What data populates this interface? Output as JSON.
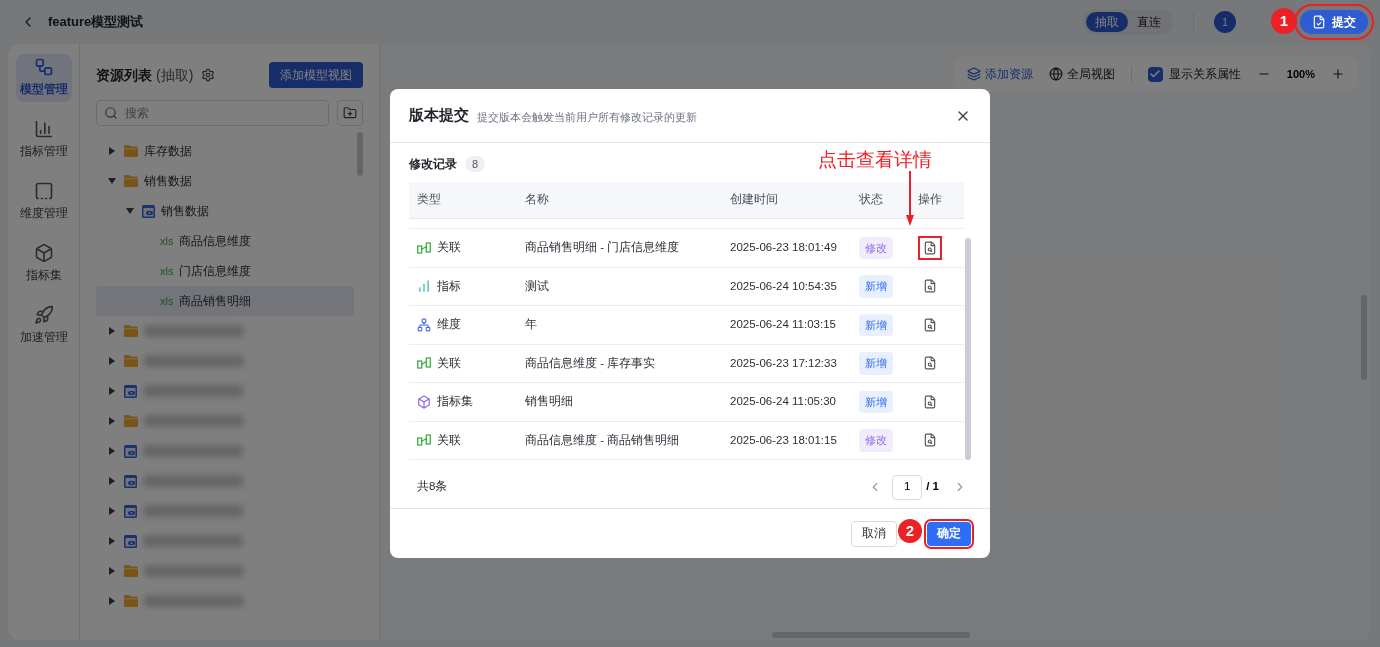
{
  "header": {
    "title": "feature模型测试",
    "mode_toggle": [
      {
        "label": "抽取",
        "selected": true
      },
      {
        "label": "直连",
        "selected": false
      }
    ],
    "avatar": "1",
    "submit_button": {
      "label": "提交",
      "highlighted": true
    }
  },
  "nav": [
    {
      "label": "模型管理",
      "kind": "model",
      "selected": true
    },
    {
      "label": "指标管理",
      "kind": "metric",
      "selected": false
    },
    {
      "label": "维度管理",
      "kind": "dimension",
      "selected": false
    },
    {
      "label": "指标集",
      "kind": "metric_set",
      "selected": false
    },
    {
      "label": "加速管理",
      "kind": "accelerate",
      "selected": false
    }
  ],
  "resource_panel": {
    "title": "资源列表",
    "mode": "(抽取)",
    "add_button": "添加模型视图",
    "search": {
      "placeholder": "搜索"
    },
    "tree": [
      {
        "label": "库存数据",
        "kind": "folder",
        "expanded": false,
        "selected": false
      },
      {
        "label": "销售数据",
        "kind": "folder",
        "expanded": true,
        "selected": false,
        "children": [
          {
            "label": "销售数据",
            "kind": "view",
            "expanded": true,
            "selected": false,
            "children": [
              {
                "label": "商品信息维度",
                "kind": "xls",
                "icon_text": "xls",
                "selected": false
              },
              {
                "label": "门店信息维度",
                "kind": "xls",
                "icon_text": "xls",
                "selected": false
              },
              {
                "label": "商品销售明细",
                "kind": "xls",
                "icon_text": "xls",
                "selected": true
              }
            ]
          }
        ]
      },
      {
        "kind": "folder",
        "expanded": false,
        "selected": false
      },
      {
        "kind": "folder",
        "expanded": false,
        "selected": false
      },
      {
        "kind": "view",
        "expanded": false,
        "selected": false
      },
      {
        "kind": "folder",
        "expanded": false,
        "selected": false
      },
      {
        "kind": "view",
        "expanded": false,
        "selected": false
      },
      {
        "kind": "view",
        "expanded": false,
        "selected": false
      },
      {
        "kind": "view",
        "expanded": false,
        "selected": false
      },
      {
        "kind": "view",
        "expanded": false,
        "selected": false
      },
      {
        "kind": "folder",
        "expanded": false,
        "selected": false
      },
      {
        "kind": "folder",
        "expanded": false,
        "selected": false
      }
    ]
  },
  "canvas_toolbar": {
    "add_resource": "添加资源",
    "global_view": "全局视图",
    "show_relations": {
      "label": "显示关系属性",
      "checked": true
    },
    "zoom": "100%"
  },
  "dialog": {
    "title": "版本提交",
    "subtitle": "提交版本会触发当前用户所有修改记录的更新",
    "section": "修改记录",
    "count": "8",
    "columns": [
      "类型",
      "名称",
      "创建时间",
      "状态",
      "操作"
    ],
    "rows": [
      {
        "type": {
          "label": "关联",
          "kind": "link"
        },
        "name": "商品销售明细 - 门店信息维度",
        "created": "2025-06-23 18:01:49",
        "status": {
          "label": "修改",
          "kind": "modify"
        },
        "highlighted": true
      },
      {
        "type": {
          "label": "指标",
          "kind": "metric"
        },
        "name": "测试",
        "created": "2025-06-24 10:54:35",
        "status": {
          "label": "新增",
          "kind": "new"
        },
        "highlighted": false
      },
      {
        "type": {
          "label": "维度",
          "kind": "dimension"
        },
        "name": "年",
        "created": "2025-06-24 11:03:15",
        "status": {
          "label": "新增",
          "kind": "new"
        },
        "highlighted": false
      },
      {
        "type": {
          "label": "关联",
          "kind": "link"
        },
        "name": "商品信息维度 - 库存事实",
        "created": "2025-06-23 17:12:33",
        "status": {
          "label": "新增",
          "kind": "new"
        },
        "highlighted": false
      },
      {
        "type": {
          "label": "指标集",
          "kind": "metric_set"
        },
        "name": "销售明细",
        "created": "2025-06-24 11:05:30",
        "status": {
          "label": "新增",
          "kind": "new"
        },
        "highlighted": false
      },
      {
        "type": {
          "label": "关联",
          "kind": "link"
        },
        "name": "商品信息维度 - 商品销售明细",
        "created": "2025-06-23 18:01:15",
        "status": {
          "label": "修改",
          "kind": "modify"
        },
        "highlighted": false
      }
    ],
    "total": "共8条",
    "page": "1",
    "page_count": "/ 1",
    "cancel_button": "取消",
    "confirm_button": {
      "label": "确定",
      "highlighted": true
    }
  },
  "annotations": {
    "callout": "点击查看详情",
    "badges": [
      "1",
      "2"
    ]
  }
}
